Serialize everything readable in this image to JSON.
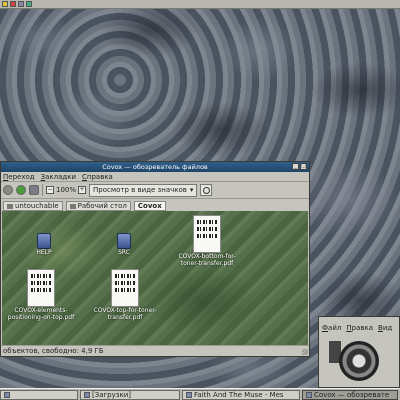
{
  "window": {
    "title": "Covox — обозреватель файлов",
    "menu": [
      "Переход",
      "Закладки",
      "Справка"
    ],
    "zoom": "100%",
    "view_mode": "Просмотр в виде значков",
    "breadcrumbs": [
      "untouchable",
      "Рабочий стол",
      "Covox"
    ],
    "status": "объектов, свободно: 4,9 ГБ",
    "items": [
      {
        "label": "HELP",
        "type": "folder"
      },
      {
        "label": "SRC",
        "type": "folder"
      },
      {
        "label": "COVOX-bottom-for-toner-transfer.pdf",
        "type": "pdf"
      },
      {
        "label": "COVOX-elements-positioning-on-top.pdf",
        "type": "pdf"
      },
      {
        "label": "COVOX-top-for-toner-transfer.pdf",
        "type": "pdf"
      }
    ]
  },
  "window2": {
    "menu": [
      "Файл",
      "Правка",
      "Вид"
    ]
  },
  "taskbar": {
    "tasks": [
      "[Загрузки]",
      "Faith And The Muse - Mes",
      "Covox — обозревате"
    ]
  }
}
